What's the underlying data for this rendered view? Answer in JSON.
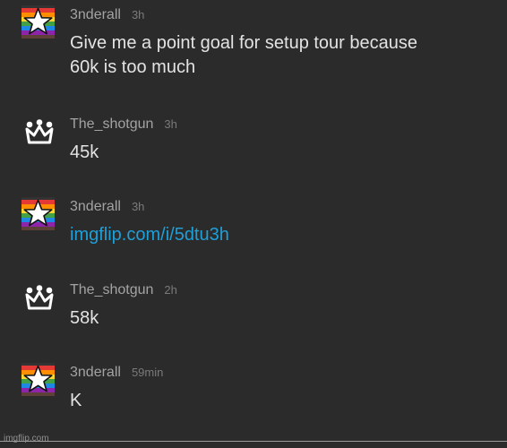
{
  "comments": [
    {
      "username": "3nderall",
      "time": "3h",
      "avatar": "rainbow-star-icon",
      "text_lines": [
        "Give me a point goal for setup tour because",
        "60k is too much"
      ]
    },
    {
      "username": "The_shotgun",
      "time": "3h",
      "avatar": "crown-icon",
      "text_lines": [
        "45k"
      ]
    },
    {
      "username": "3nderall",
      "time": "3h",
      "avatar": "rainbow-star-icon",
      "link": "imgflip.com/i/5dtu3h"
    },
    {
      "username": "The_shotgun",
      "time": "2h",
      "avatar": "crown-icon",
      "text_lines": [
        "58k"
      ]
    },
    {
      "username": "3nderall",
      "time": "59min",
      "avatar": "rainbow-star-icon",
      "text_lines": [
        "K"
      ]
    }
  ],
  "watermark": "imgflip.com",
  "colors": {
    "background": "#2b2b2b",
    "username": "#a3a3a3",
    "timestamp": "#7a7a7a",
    "text": "#e3e3e3",
    "link": "#1e9fd8"
  }
}
